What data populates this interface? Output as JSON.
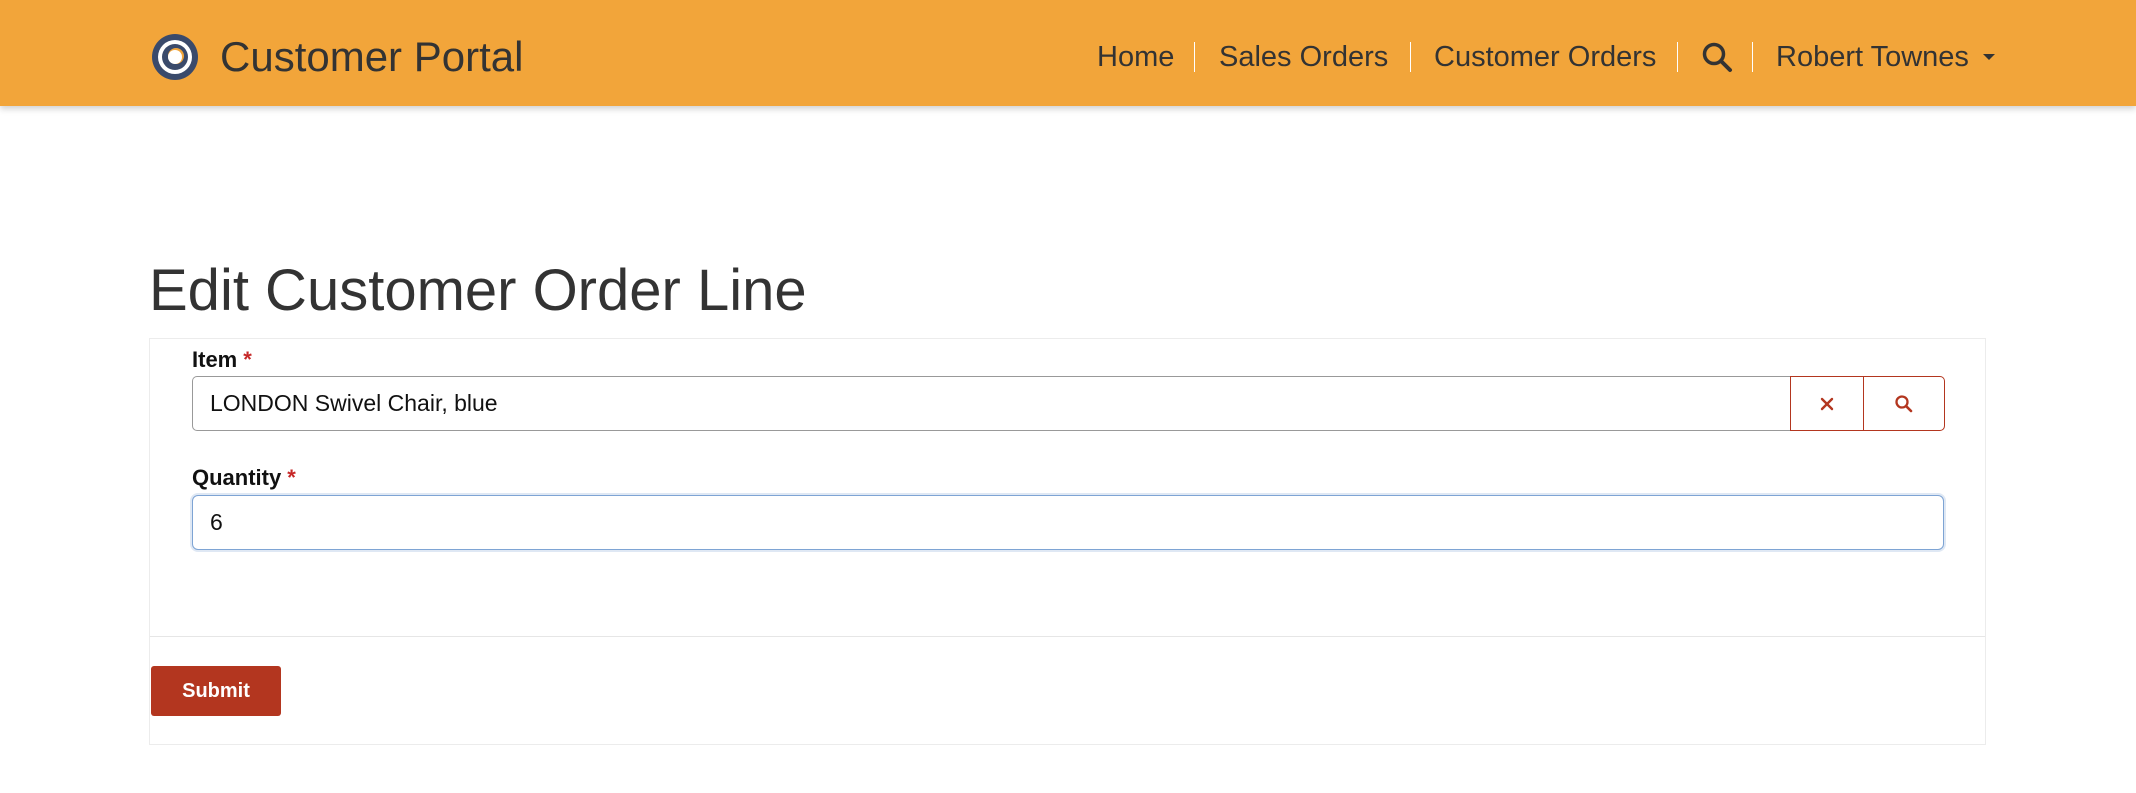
{
  "header": {
    "app_title": "Customer Portal",
    "nav": [
      {
        "label": "Home"
      },
      {
        "label": "Sales Orders"
      },
      {
        "label": "Customer Orders"
      }
    ],
    "search_icon": "search-icon",
    "user": {
      "name": "Robert Townes"
    },
    "background_color": "#f2a53a"
  },
  "page": {
    "title": "Edit Customer Order Line"
  },
  "form": {
    "item": {
      "label": "Item",
      "required_mark": "*",
      "value": "LONDON Swivel Chair, blue",
      "clear_icon": "close-icon",
      "lookup_icon": "search-icon"
    },
    "quantity": {
      "label": "Quantity",
      "required_mark": "*",
      "value": "6"
    },
    "submit_label": "Submit",
    "accent_color": "#b3361f"
  }
}
